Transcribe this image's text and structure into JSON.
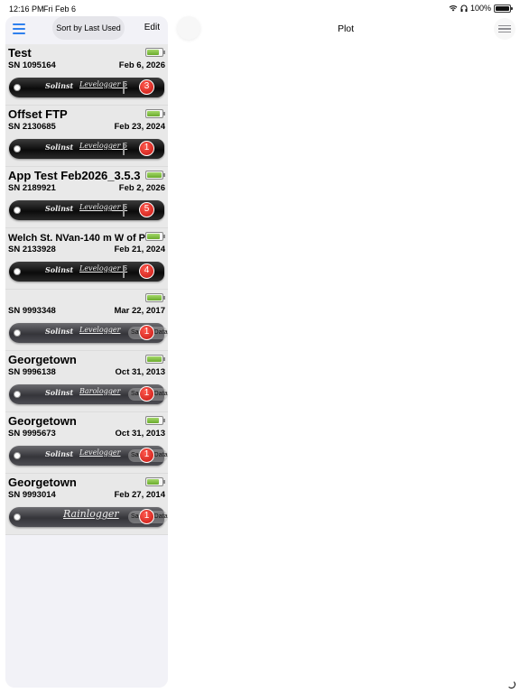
{
  "status_bar": {
    "time": "12:16 PM",
    "date": "Fri Feb 6",
    "battery_text": "100%",
    "icons": [
      "wifi-icon",
      "headphones-icon",
      "battery-icon"
    ]
  },
  "sidebar": {
    "sort_label": "Sort by Last Used",
    "edit_label": "Edit",
    "devices": [
      {
        "name": "Test",
        "sn": "SN 1095164",
        "date": "Feb 6, 2026",
        "brand": "Solinst",
        "model": "Levelogger 5",
        "badge": "3",
        "battery_level": 0.8
      },
      {
        "name": "Offset FTP",
        "sn": "SN 2130685",
        "date": "Feb 23, 2024",
        "brand": "Solinst",
        "model": "Levelogger 5",
        "badge": "1",
        "battery_level": 0.9
      },
      {
        "name": "App Test Feb2026_3.5.3",
        "sn": "SN 2189921",
        "date": "Feb 2, 2026",
        "brand": "Solinst",
        "model": "Levelogger 5",
        "badge": "5",
        "battery_level": 1.0
      },
      {
        "name": "Welch St. NVan-140 m W of P",
        "sn": "SN 2133928",
        "date": "Feb 21, 2024",
        "brand": "Solinst",
        "model": "Levelogger 5",
        "badge": "4",
        "battery_level": 0.9
      },
      {
        "name": "",
        "sn": "SN 9993348",
        "date": "Mar 22, 2017",
        "brand": "Solinst",
        "model": "Levelogger",
        "badge": "1",
        "pill": "Sample Data",
        "battery_level": 1.0
      },
      {
        "name": "Georgetown",
        "sn": "SN 9996138",
        "date": "Oct 31, 2013",
        "brand": "Solinst",
        "model": "Barologger",
        "badge": "1",
        "pill": "Sample Data",
        "battery_level": 1.0
      },
      {
        "name": "Georgetown",
        "sn": "SN 9995673",
        "date": "Oct 31, 2013",
        "brand": "Solinst",
        "model": "Levelogger",
        "badge": "1",
        "pill": "Sample Data",
        "battery_level": 0.8
      },
      {
        "name": "Georgetown",
        "sn": "SN 9993014",
        "date": "Feb 27, 2014",
        "brand": "",
        "model": "Rainlogger",
        "badge": "1",
        "pill": "Sample Data",
        "battery_level": 0.8
      }
    ]
  },
  "main": {
    "title": "Plot"
  }
}
